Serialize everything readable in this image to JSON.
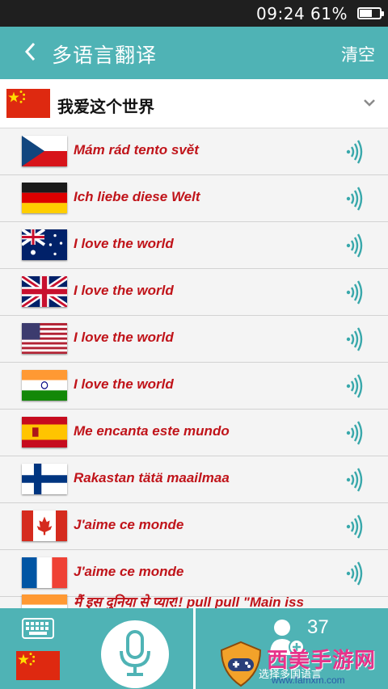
{
  "status_bar": {
    "time": "09:24",
    "battery": "61%",
    "battery_level": 0.61
  },
  "header": {
    "back_icon": "chevron-left-icon",
    "title": "多语言翻译",
    "clear_label": "清空"
  },
  "source": {
    "flag": "china-flag",
    "text": "我爱这个世界"
  },
  "translations": [
    {
      "flag": "czech-flag",
      "text": "Mám rád tento svět"
    },
    {
      "flag": "germany-flag",
      "text": "Ich liebe diese Welt"
    },
    {
      "flag": "australia-flag",
      "text": "I love the world"
    },
    {
      "flag": "uk-flag",
      "text": "I love the world"
    },
    {
      "flag": "usa-flag",
      "text": "I love the world"
    },
    {
      "flag": "india-flag",
      "text": "I love the world"
    },
    {
      "flag": "spain-flag",
      "text": "Me encanta este mundo"
    },
    {
      "flag": "finland-flag",
      "text": "Rakastan tätä maailmaa"
    },
    {
      "flag": "canada-flag",
      "text": "J'aime ce monde"
    },
    {
      "flag": "france-flag",
      "text": "J'aime ce monde"
    },
    {
      "flag": "india-flag",
      "text": "मैं इस दुनिया से प्यार!! pull pull \"Main iss"
    }
  ],
  "bottom_bar": {
    "keyboard_icon": "keyboard-icon",
    "mic_icon": "microphone-icon",
    "people_icon": "people-add-icon",
    "count": "37",
    "multi_label": "选择多国语言"
  },
  "watermark": {
    "text": "西美手游网",
    "url": "www.famxm.com"
  },
  "colors": {
    "accent": "#4fb3b5",
    "translation_text": "#c0141a",
    "status_bar": "#1f1f1f"
  }
}
